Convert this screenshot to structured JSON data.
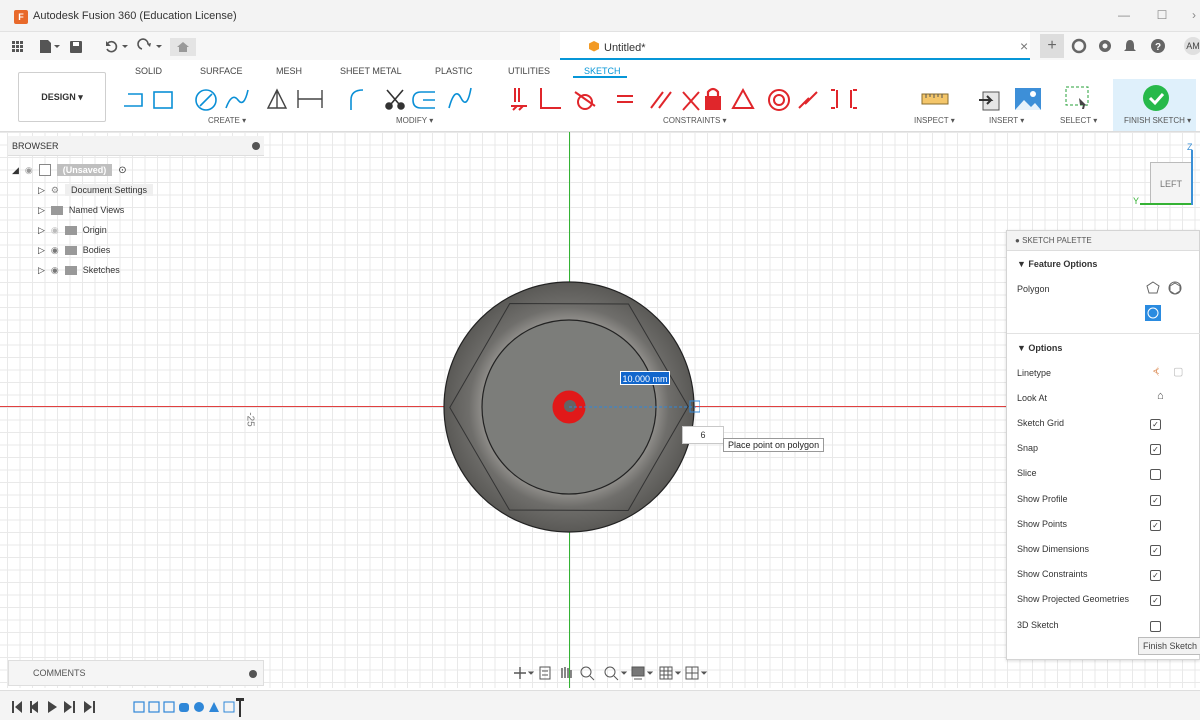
{
  "window": {
    "title": "Autodesk Fusion 360 (Education License)",
    "app_icon_letter": "F"
  },
  "document": {
    "tab_label": "Untitled*",
    "user_initials": "AM"
  },
  "ribbon": {
    "workspace_button": "DESIGN ▾",
    "tabs": [
      "SOLID",
      "SURFACE",
      "MESH",
      "SHEET METAL",
      "PLASTIC",
      "UTILITIES",
      "SKETCH"
    ],
    "active_tab": "SKETCH",
    "groups": {
      "create": "CREATE ▾",
      "modify": "MODIFY ▾",
      "constraints": "CONSTRAINTS ▾",
      "inspect": "INSPECT ▾",
      "insert": "INSERT ▾",
      "select": "SELECT ▾",
      "finish": "FINISH SKETCH ▾"
    }
  },
  "browser": {
    "title": "BROWSER",
    "root": "(Unsaved)",
    "items": [
      "Document Settings",
      "Named Views",
      "Origin",
      "Bodies",
      "Sketches"
    ]
  },
  "viewport": {
    "axis_label": "-25",
    "viewcube_face": "LEFT",
    "viewcube_axis_z": "Z",
    "viewcube_axis_y": "Y",
    "dimension_value": "10.000 mm",
    "sides_value": "6",
    "tooltip": "Place point on polygon"
  },
  "palette": {
    "title": "SKETCH PALETTE",
    "feature_options_header": "▼ Feature Options",
    "polygon_label": "Polygon",
    "options_header": "▼ Options",
    "linetype_label": "Linetype",
    "lookat_label": "Look At",
    "options": [
      {
        "label": "Sketch Grid",
        "checked": true
      },
      {
        "label": "Snap",
        "checked": true
      },
      {
        "label": "Slice",
        "checked": false
      },
      {
        "label": "Show Profile",
        "checked": true
      },
      {
        "label": "Show Points",
        "checked": true
      },
      {
        "label": "Show Dimensions",
        "checked": true
      },
      {
        "label": "Show Constraints",
        "checked": true
      },
      {
        "label": "Show Projected Geometries",
        "checked": true
      },
      {
        "label": "3D Sketch",
        "checked": false
      }
    ],
    "finish_button": "Finish Sketch"
  },
  "comments": {
    "title": "COMMENTS"
  },
  "colors": {
    "accent": "#0696d7",
    "finish_green": "#27b94a",
    "constraint_red": "#e0262b",
    "axis_red": "#e04040",
    "axis_green": "#34b234",
    "part_gray": "#7a7b78"
  }
}
